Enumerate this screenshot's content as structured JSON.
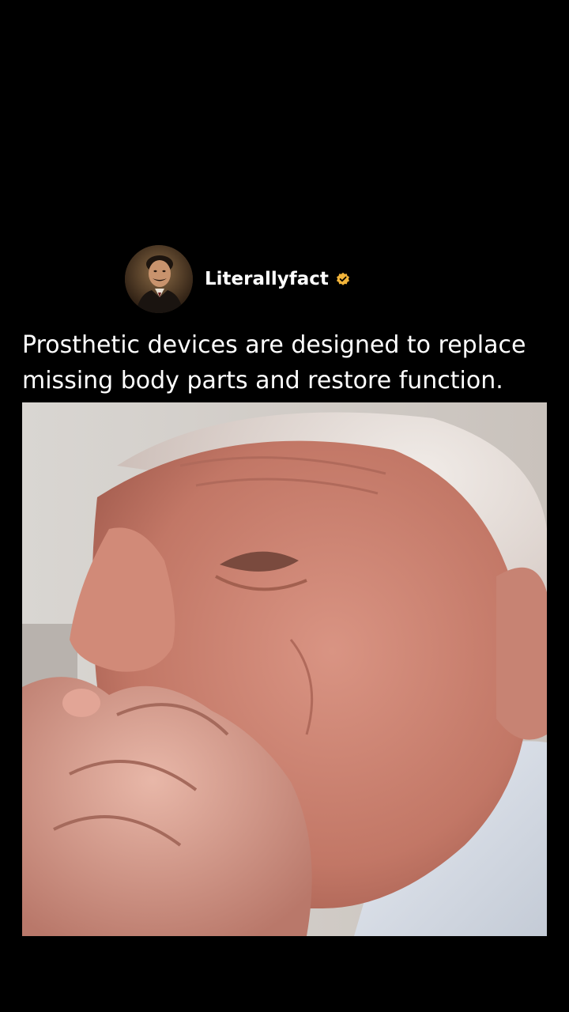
{
  "post": {
    "author": {
      "username": "Literallyfact",
      "verified": true,
      "avatar_icon": "portrait-avatar"
    },
    "caption": "Prosthetic devices are designed to replace\nmissing body parts and restore function.",
    "media": {
      "kind": "video-frame"
    }
  },
  "colors": {
    "background": "#000000",
    "text": "#ffffff",
    "verified_badge": "#f2b43a"
  }
}
